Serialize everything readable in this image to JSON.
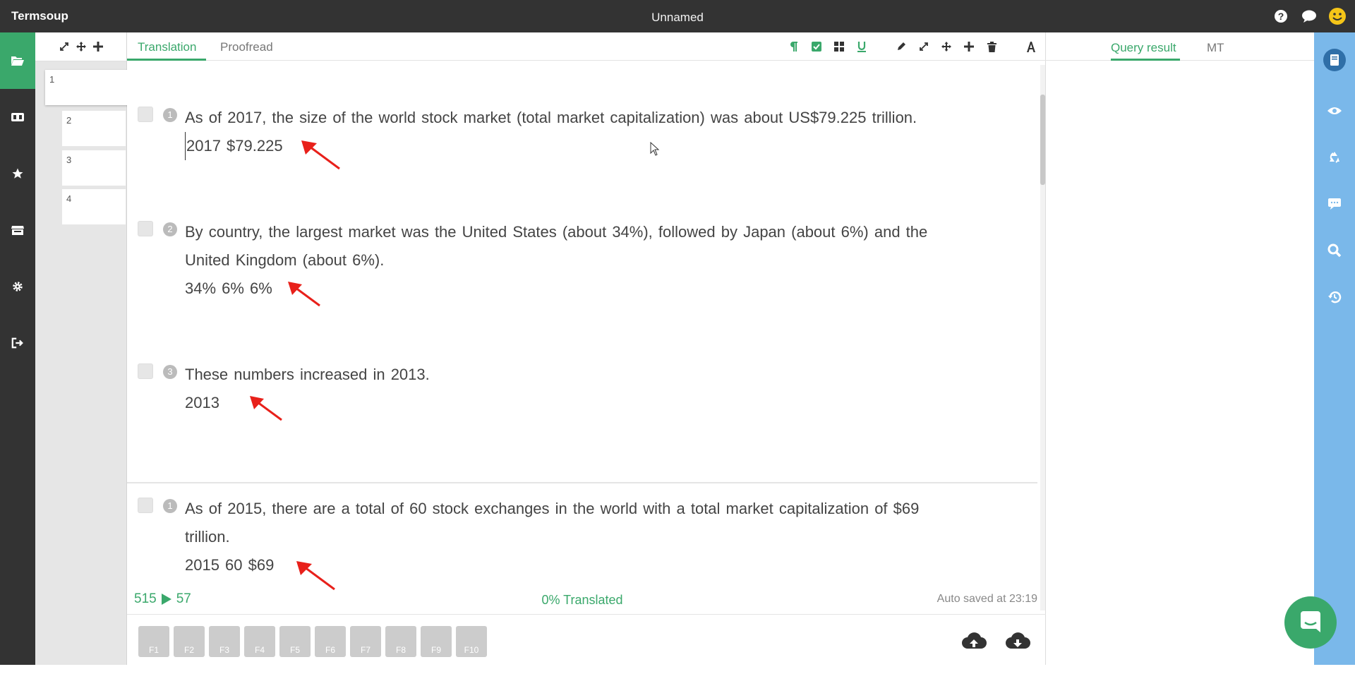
{
  "app": {
    "name": "Termsoup",
    "document_title": "Unnamed"
  },
  "top_icons": [
    "help-icon",
    "chat-icon",
    "smiley-avatar-icon"
  ],
  "left_nav": {
    "items": [
      {
        "name": "folder-open-icon",
        "active": true
      },
      {
        "name": "glossary-icon",
        "active": false
      },
      {
        "name": "star-icon",
        "active": false
      },
      {
        "name": "store-icon",
        "active": false
      },
      {
        "name": "gear-icon",
        "active": false
      },
      {
        "name": "sign-out-icon",
        "active": false
      }
    ]
  },
  "thumbnails": {
    "items": [
      "1",
      "2",
      "3",
      "4"
    ]
  },
  "editor": {
    "tabs": [
      {
        "label": "Translation"
      },
      {
        "label": "Proofread"
      }
    ],
    "toolbar_icons": [
      "paragraph-icon",
      "check-square-icon",
      "grid-icon",
      "underline-icon",
      "pencil-icon",
      "compress-icon",
      "move-icon",
      "plus-icon",
      "trash-icon",
      "font-icon"
    ],
    "segments": [
      {
        "number": "1",
        "source": "As of 2017, the size of the world stock market (total market capitalization) was about US$79.225 trillion.",
        "target": "2017 $79.225"
      },
      {
        "number": "2",
        "source": "By country, the largest market was the United States (about 34%), followed by Japan (about 6%) and the United Kingdom (about 6%).",
        "target": "34% 6% 6%"
      },
      {
        "number": "3",
        "source": "These numbers increased in 2013.",
        "target": "2013"
      },
      {
        "number": "1",
        "source": "As of 2015, there are a total of 60 stock exchanges in the world with a total market capitalization of $69 trillion.",
        "target": "2015 60 $69"
      }
    ],
    "status": {
      "left_count": "515",
      "right_count": "57",
      "translated": "0% Translated",
      "autosave": "Auto saved at 23:19"
    },
    "fkeys": [
      "F1",
      "F2",
      "F3",
      "F4",
      "F5",
      "F6",
      "F7",
      "F8",
      "F9",
      "F10"
    ],
    "cloud_icons": [
      "cloud-upload-icon",
      "cloud-download-icon"
    ]
  },
  "right_panel": {
    "tabs": [
      {
        "label": "Query result"
      },
      {
        "label": "MT"
      }
    ]
  },
  "rail_icons": [
    "book-icon",
    "eye-icon",
    "recycle-icon",
    "comment-icon",
    "search-icon",
    "history-icon"
  ],
  "colors": {
    "accent": "#3aa86b",
    "topbar": "#333333",
    "rail": "#7ab8ea",
    "arrow": "#e8201a"
  }
}
